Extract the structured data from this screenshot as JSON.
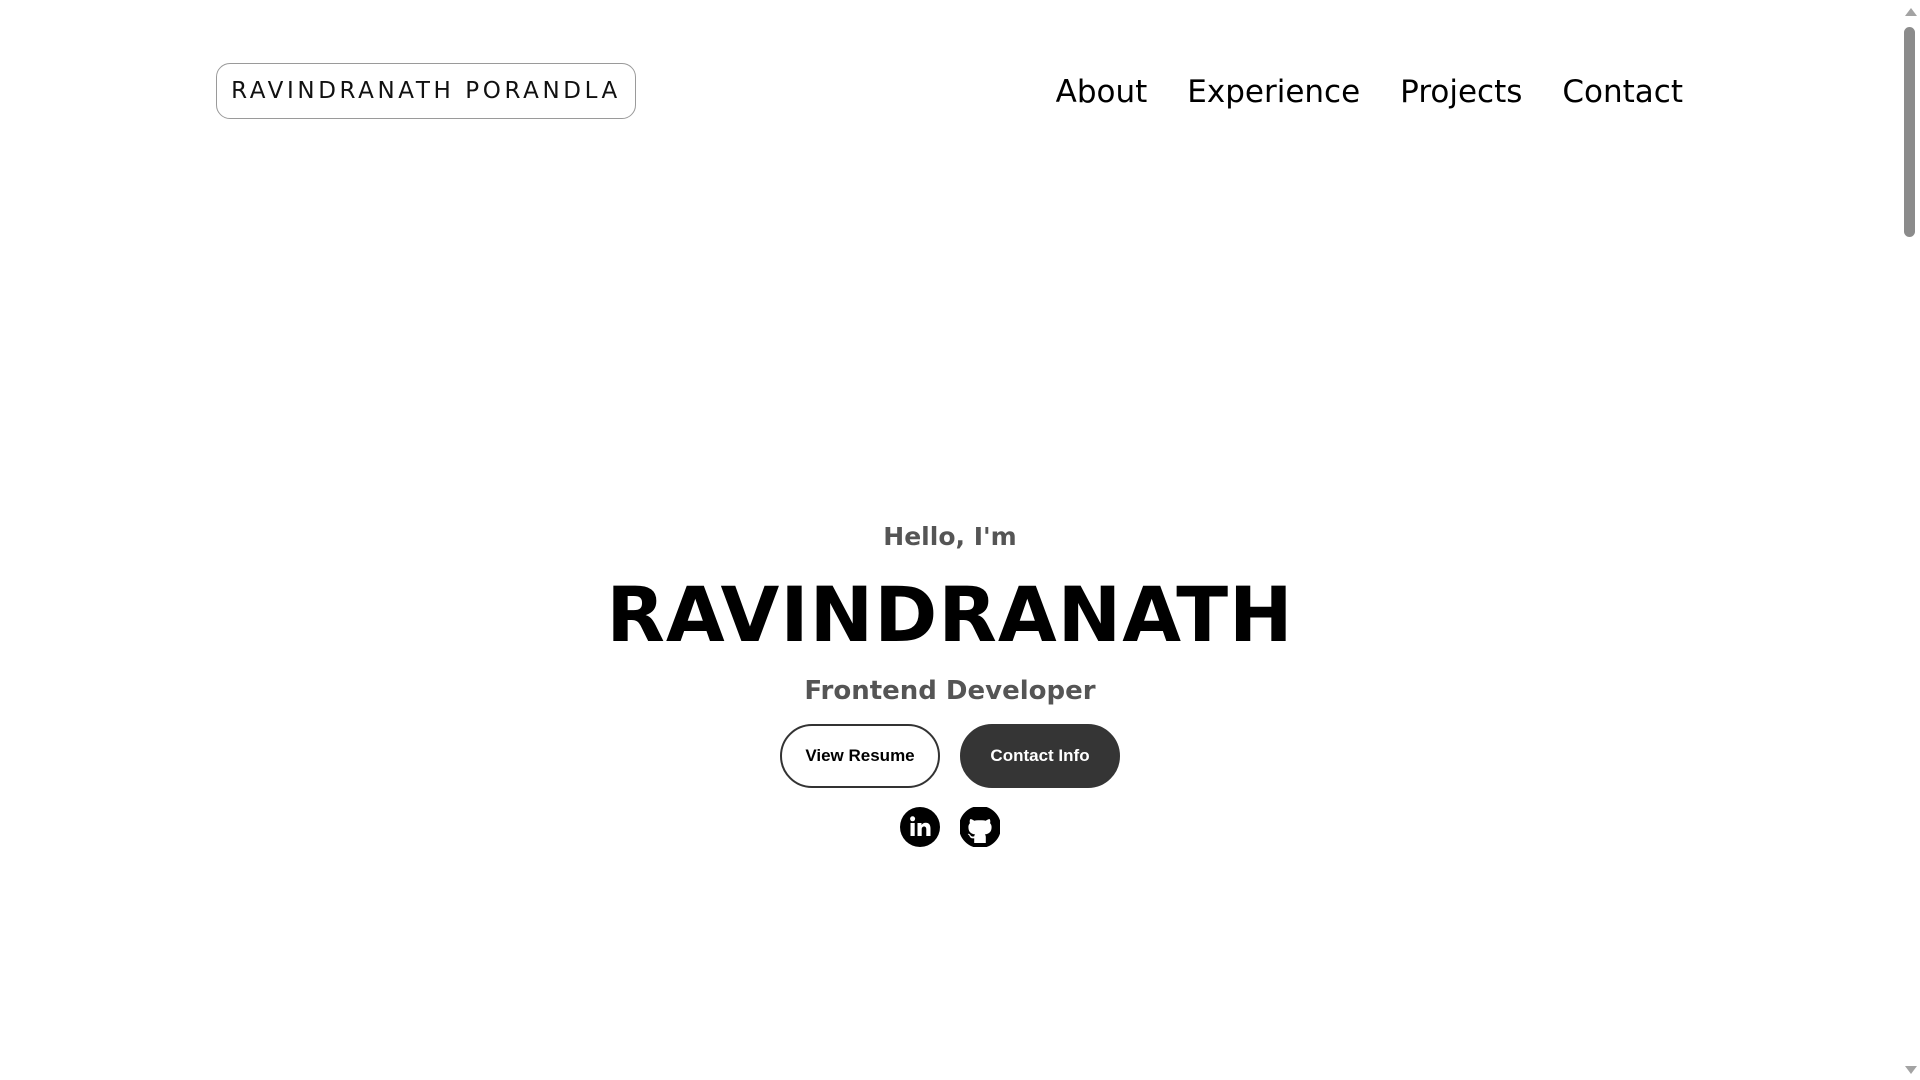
{
  "header": {
    "logo_text": "RAVINDRANATH PORANDLA",
    "nav": [
      {
        "label": "About"
      },
      {
        "label": "Experience"
      },
      {
        "label": "Projects"
      },
      {
        "label": "Contact"
      }
    ]
  },
  "hero": {
    "greeting": "Hello, I'm",
    "name": "RAVINDRANATH",
    "role": "Frontend Developer",
    "buttons": {
      "resume": "View Resume",
      "contact": "Contact Info"
    },
    "socials": [
      {
        "icon": "linkedin-icon"
      },
      {
        "icon": "github-icon"
      }
    ]
  },
  "colors": {
    "text": "#000000",
    "muted": "#555555",
    "button_dark": "#353535",
    "background": "#ffffff"
  }
}
